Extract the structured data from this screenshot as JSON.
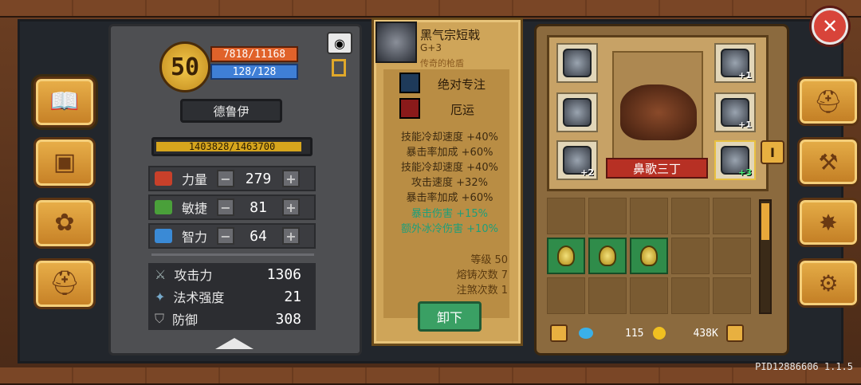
{
  "hero": {
    "level": "50",
    "hp": "7818/11168",
    "mp": "128/128",
    "name": "德鲁伊",
    "exp": "1403828/1463700",
    "exp_fraction": 0.959
  },
  "attributes": [
    {
      "label": "力量",
      "value": "279"
    },
    {
      "label": "敏捷",
      "value": "81"
    },
    {
      "label": "智力",
      "value": "64"
    }
  ],
  "combat": [
    {
      "label": "攻击力",
      "value": "1306"
    },
    {
      "label": "法术强度",
      "value": "21"
    },
    {
      "label": "防御",
      "value": "308"
    }
  ],
  "item": {
    "name": "黑气宗短戟",
    "grade": "G+3",
    "rarity": "传奇的枪盾",
    "skills": [
      "绝对专注",
      "厄运"
    ],
    "effects": [
      {
        "text": "技能冷却速度 +40%",
        "color": "normal"
      },
      {
        "text": "暴击率加成 +60%",
        "color": "normal"
      },
      {
        "text": "技能冷却速度 +40%",
        "color": "normal"
      },
      {
        "text": "攻击速度 +32%",
        "color": "normal"
      },
      {
        "text": "暴击率加成 +60%",
        "color": "normal"
      },
      {
        "text": "暴击伤害 +15%",
        "color": "green"
      },
      {
        "text": "额外冰冷伤害 +10%",
        "color": "green"
      }
    ],
    "level_label": "等级 50",
    "forge_label": "熔铸次数 7",
    "inject_label": "注煞次数 1",
    "unequip_label": "卸下"
  },
  "equipment": {
    "pet_name": "鼻歌三丁",
    "slot_plus": [
      "+1",
      "+1",
      "+2",
      "+3"
    ]
  },
  "inventory": {
    "gems": "115",
    "gold": "438K"
  },
  "pid": "PID12886606 1.1.5"
}
